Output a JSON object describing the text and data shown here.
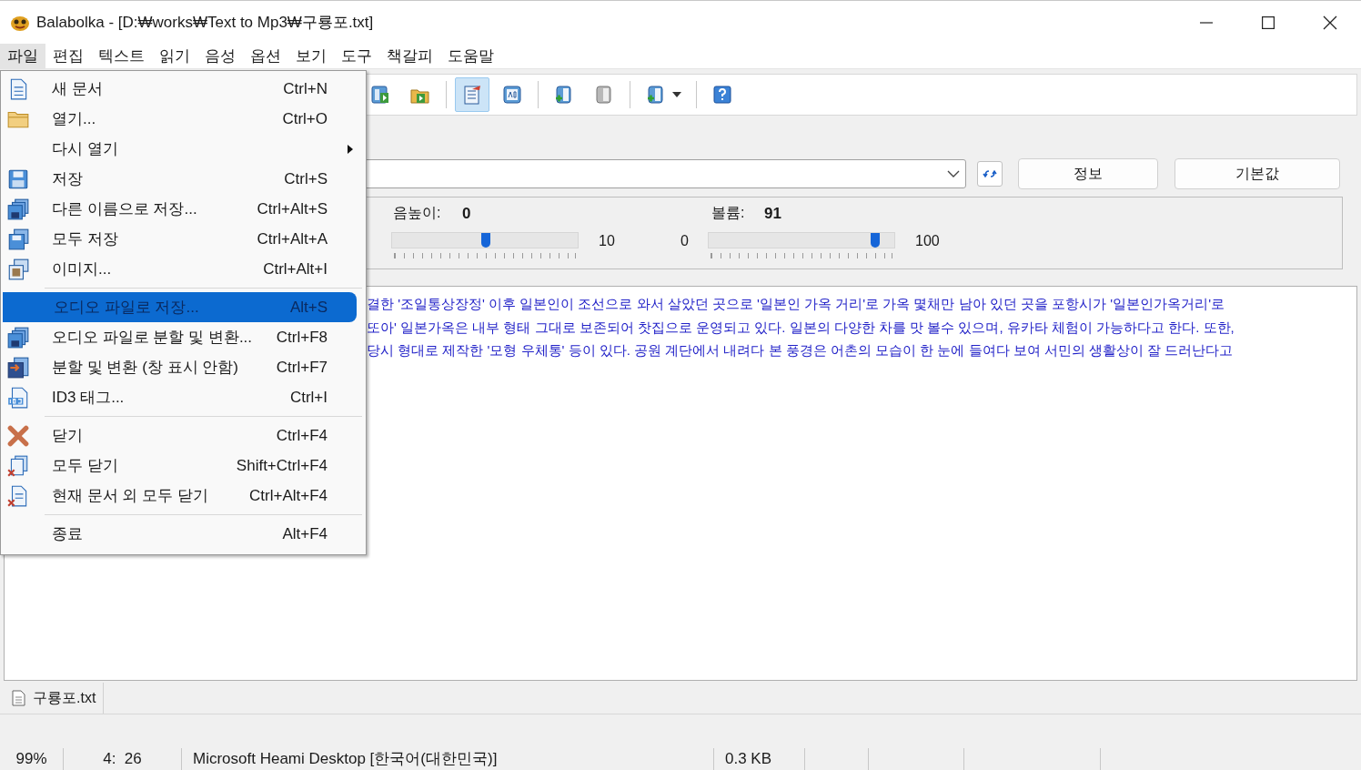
{
  "window": {
    "title": "Balabolka - [D:₩works₩Text to Mp3₩구룡포.txt]"
  },
  "menu_bar": [
    {
      "label": "파일",
      "selected": true
    },
    {
      "label": "편집",
      "selected": false
    },
    {
      "label": "텍스트",
      "selected": false
    },
    {
      "label": "읽기",
      "selected": false
    },
    {
      "label": "음성",
      "selected": false
    },
    {
      "label": "옵션",
      "selected": false
    },
    {
      "label": "보기",
      "selected": false
    },
    {
      "label": "도구",
      "selected": false
    },
    {
      "label": "책갈피",
      "selected": false
    },
    {
      "label": "도움말",
      "selected": false
    }
  ],
  "toolbar": [
    {
      "kind": "button",
      "selected": false
    },
    {
      "kind": "button",
      "selected": false
    },
    {
      "kind": "separator"
    },
    {
      "kind": "button",
      "selected": true
    },
    {
      "kind": "button",
      "selected": false
    },
    {
      "kind": "separator"
    },
    {
      "kind": "button",
      "selected": false
    },
    {
      "kind": "button",
      "selected": false
    },
    {
      "kind": "separator"
    },
    {
      "kind": "dropdown",
      "selected": false
    },
    {
      "kind": "separator"
    },
    {
      "kind": "button",
      "selected": false
    }
  ],
  "voice_panel": {
    "buttons": [
      "정보",
      "기본값"
    ]
  },
  "sliders": [
    {
      "label": "음높이:",
      "value": "0",
      "level": 0.5,
      "max": "10"
    },
    {
      "label": "볼륨:",
      "value": "91",
      "level": 0.91,
      "min": "0",
      "max": "100"
    }
  ],
  "text_lines": [
    "결한 '조일통상장정' 이후 일본인이 조선으로 와서 살았던 곳으로 '일본인 가옥 거리'로 가옥 몇채만 남아 있던 곳을 포항시가 '일본인가옥거리'로",
    "또아' 일본가옥은 내부 형태 그대로 보존되어 찻집으로 운영되고 있다. 일본의 다양한 차를 맛 볼수 있으며, 유카타 체험이 가능하다고 한다. 또한,",
    "당시 형대로 제작한 '모형 우체통' 등이 있다. 공원 계단에서 내려다 본 풍경은 어촌의 모습이 한 눈에 들여다 보여 서민의 생활상이 잘 드러난다고"
  ],
  "file_menu": [
    {
      "kind": "item",
      "label": "새 문서",
      "shortcut": "Ctrl+N",
      "selected": false
    },
    {
      "kind": "item",
      "label": "열기...",
      "shortcut": "Ctrl+O",
      "selected": false
    },
    {
      "kind": "submenu",
      "label": "다시 열기",
      "selected": false
    },
    {
      "kind": "item",
      "label": "저장",
      "shortcut": "Ctrl+S",
      "selected": false
    },
    {
      "kind": "item",
      "label": "다른 이름으로 저장...",
      "shortcut": "Ctrl+Alt+S",
      "selected": false
    },
    {
      "kind": "item",
      "label": "모두 저장",
      "shortcut": "Ctrl+Alt+A",
      "selected": false
    },
    {
      "kind": "item",
      "label": "이미지...",
      "shortcut": "Ctrl+Alt+I",
      "selected": false
    },
    {
      "kind": "separator"
    },
    {
      "kind": "item",
      "label": "오디오 파일로 저장...",
      "shortcut": "Alt+S",
      "selected": true
    },
    {
      "kind": "item",
      "label": "오디오 파일로 분할 및 변환...",
      "shortcut": "Ctrl+F8",
      "selected": false
    },
    {
      "kind": "item",
      "label": "분할 및 변환 (창 표시 안함)",
      "shortcut": "Ctrl+F7",
      "selected": false
    },
    {
      "kind": "item",
      "label": "ID3 태그...",
      "shortcut": "Ctrl+I",
      "selected": false
    },
    {
      "kind": "separator"
    },
    {
      "kind": "item",
      "label": "닫기",
      "shortcut": "Ctrl+F4",
      "selected": false
    },
    {
      "kind": "item",
      "label": "모두 닫기",
      "shortcut": "Shift+Ctrl+F4",
      "selected": false
    },
    {
      "kind": "item",
      "label": "현재 문서 외 모두 닫기",
      "shortcut": "Ctrl+Alt+F4",
      "selected": false
    },
    {
      "kind": "separator"
    },
    {
      "kind": "item",
      "label": "종료",
      "shortcut": "Alt+F4",
      "selected": false
    }
  ],
  "document_tabs": [
    {
      "label": "구룡포.txt",
      "selected": true
    }
  ],
  "status_bar": [
    "99%",
    "4:  26",
    "Microsoft Heami Desktop [한국어(대한민국)]",
    "0.3 KB"
  ]
}
